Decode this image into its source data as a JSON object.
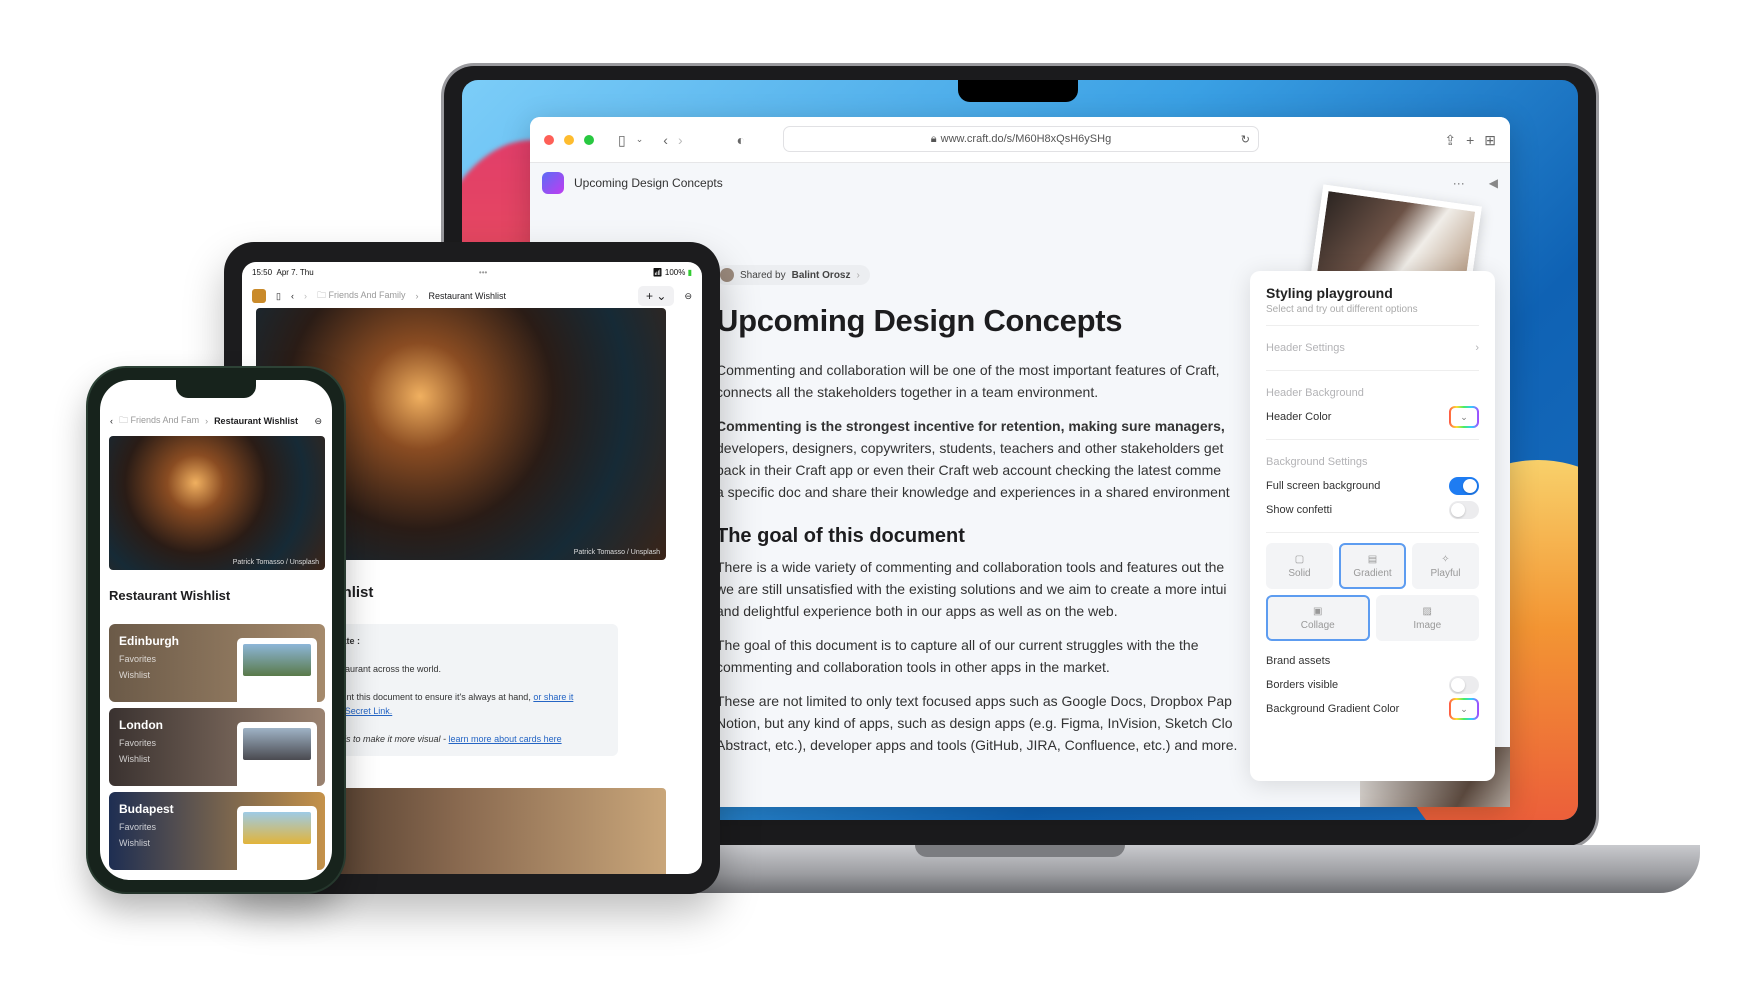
{
  "browser": {
    "url": "www.craft.do/s/M60H8xQsH6ySHg",
    "app_title": "Upcoming Design Concepts"
  },
  "document": {
    "shared_prefix": "Shared by",
    "shared_by": "Balint Orosz",
    "title": "Upcoming Design Concepts",
    "para1_line1": "Commenting and collaboration will be one of the most important features of Craft,",
    "para1_line2": "connects all the stakeholders together in a team environment.",
    "para2_bold": "Commenting is the strongest incentive for retention, making sure managers,",
    "para2_line2": "developers, designers, copywriters, students, teachers and other stakeholders get",
    "para2_line3": "back in their Craft app or even their Craft web account checking the latest comme",
    "para2_line4": "a specific doc and share their knowledge and experiences in a shared environment",
    "heading2": "The goal of this document",
    "para3_line1": "There is a wide variety of commenting and collaboration tools and features out the",
    "para3_line2": "we are still unsatisfied with the existing solutions and we aim to create a more intui",
    "para3_line3": "and delightful experience both in our apps as well as on the web.",
    "para4_line1": "The goal of this document is to capture all of our current struggles with the the",
    "para4_line2": "commenting and collaboration tools in other apps in the market.",
    "para5_line1": "These are not limited to only text focused apps such as Google Docs, Dropbox Pap",
    "para5_line2": "Notion, but any kind of apps, such as design apps (e.g. Figma, InVision, Sketch Clo",
    "para5_line3": "Abstract, etc.), developer apps and tools (GitHub, JIRA, Confluence, etc.) and more."
  },
  "panel": {
    "title": "Styling playground",
    "subtitle": "Select and try out different options",
    "header_settings": "Header Settings",
    "header_background": "Header Background",
    "header_color": "Header Color",
    "background_settings": "Background Settings",
    "full_screen_background": "Full screen background",
    "full_screen_background_on": true,
    "show_confetti": "Show confetti",
    "show_confetti_on": false,
    "options": [
      "Solid",
      "Gradient",
      "Playful",
      "Collage",
      "Image"
    ],
    "selected_options": [
      "Gradient",
      "Collage"
    ],
    "brand_assets": "Brand assets",
    "borders_visible": "Borders visible",
    "borders_visible_on": false,
    "background_gradient_color": "Background Gradient Color"
  },
  "tablet": {
    "time": "15:50",
    "date": "Apr 7. Thu",
    "battery": "100%",
    "crumb_parent": "Friends And Family",
    "crumb_current": "Restaurant Wishlist",
    "photo_credit": "Patrick Tomasso / Unsplash",
    "heading": "Wishlist",
    "template_label": "s template :",
    "template_line1": "orite restaurant across the world.",
    "template_line2a": "sily 🖶 print this document to ensure it's always at hand, ",
    "template_link1": "or share it",
    "template_link2": "s via 🔗 Secret Link.",
    "template_line3": "ses Cards to make it more visual - ",
    "template_link3": "learn more about cards here"
  },
  "phone": {
    "crumb_parent": "Friends And Fam",
    "crumb_current": "Restaurant Wishlist",
    "photo_credit": "Patrick Tomasso / Unsplash",
    "heading": "Restaurant Wishlist",
    "cities": [
      {
        "name": "Edinburgh",
        "tag1": "Favorites",
        "tag2": "Wishlist"
      },
      {
        "name": "London",
        "tag1": "Favorites",
        "tag2": "Wishlist"
      },
      {
        "name": "Budapest",
        "tag1": "Favorites",
        "tag2": "Wishlist"
      }
    ]
  }
}
